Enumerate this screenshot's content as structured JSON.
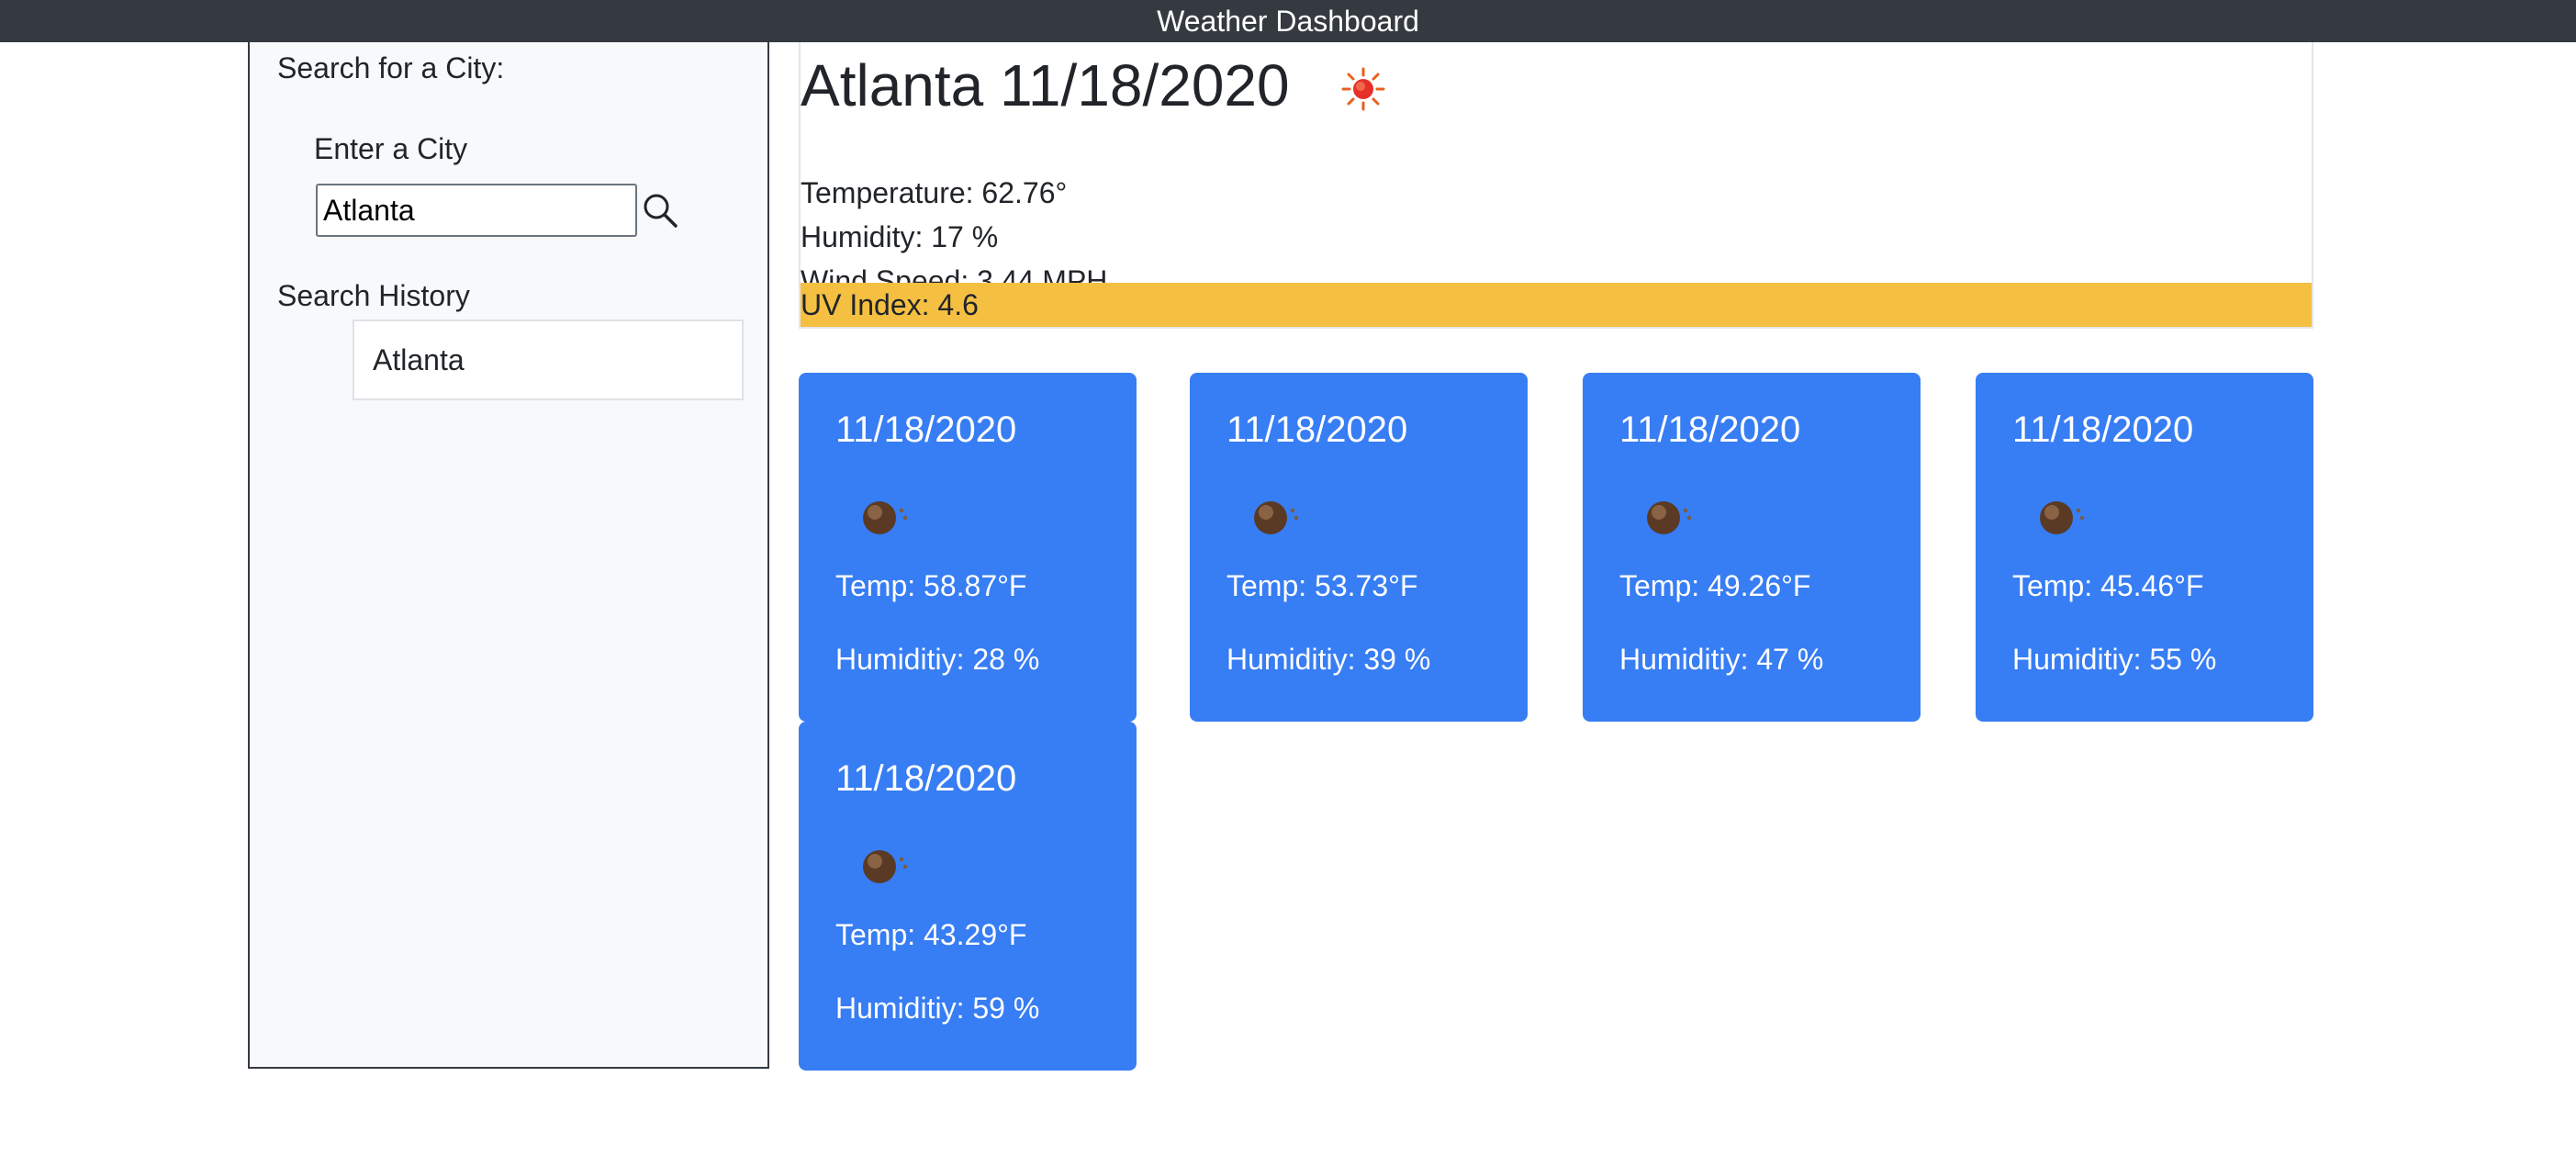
{
  "header": {
    "title": "Weather Dashboard"
  },
  "sidebar": {
    "search_title": "Search for a City:",
    "enter_label": "Enter a City",
    "city_input_value": "Atlanta",
    "search_icon": "search-icon",
    "history_title": "Search History",
    "history": [
      "Atlanta"
    ]
  },
  "current": {
    "city": "Atlanta",
    "date": "11/18/2020",
    "icon": "sun-icon",
    "temperature": "Temperature: 62.76°",
    "humidity": "Humidity: 17 %",
    "wind": "Wind Speed: 3.44 MPH",
    "uv": "UV Index: 4.6",
    "uv_color": "#f5c042"
  },
  "forecast": [
    {
      "date": "11/18/2020",
      "icon": "cloud-icon",
      "temp": "Temp: 58.87°F",
      "humidity": "Humiditiy: 28 %"
    },
    {
      "date": "11/18/2020",
      "icon": "cloud-icon",
      "temp": "Temp: 53.73°F",
      "humidity": "Humiditiy: 39 %"
    },
    {
      "date": "11/18/2020",
      "icon": "cloud-icon",
      "temp": "Temp: 49.26°F",
      "humidity": "Humiditiy: 47 %"
    },
    {
      "date": "11/18/2020",
      "icon": "cloud-icon",
      "temp": "Temp: 45.46°F",
      "humidity": "Humiditiy: 55 %"
    },
    {
      "date": "11/18/2020",
      "icon": "cloud-icon",
      "temp": "Temp: 43.29°F",
      "humidity": "Humiditiy: 59 %"
    }
  ],
  "colors": {
    "navbar": "#343a40",
    "card": "#377df4",
    "sidebar": "#f8f9fa"
  }
}
